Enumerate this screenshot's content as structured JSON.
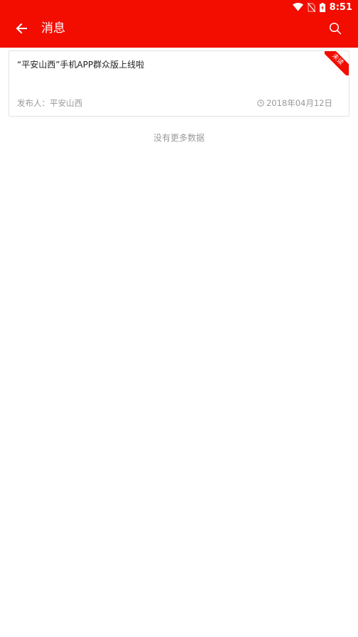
{
  "status_bar": {
    "time": "8:51",
    "icons": [
      "wifi-icon",
      "no-sim-icon",
      "battery-charging-icon"
    ]
  },
  "header": {
    "title": "消息",
    "back_icon": "arrow-left-icon",
    "search_icon": "search-icon"
  },
  "messages": [
    {
      "title": "“平安山西”手机APP群众版上线啦",
      "publisher": "发布人：平安山西",
      "date": "2018年04月12日",
      "badge": "未读"
    }
  ],
  "footer": {
    "no_more_text": "没有更多数据"
  },
  "colors": {
    "accent": "#f20d00",
    "text_primary": "#222222",
    "text_secondary": "#999999"
  }
}
